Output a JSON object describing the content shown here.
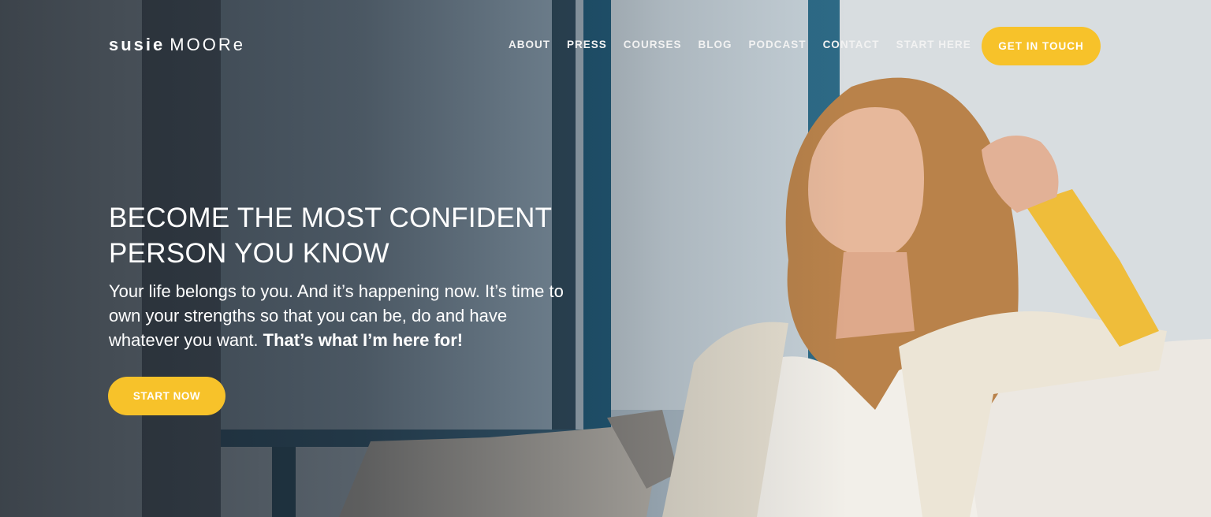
{
  "brand": {
    "first": "susie",
    "last": "MOORe"
  },
  "nav": {
    "items": [
      {
        "label": "ABOUT"
      },
      {
        "label": "PRESS"
      },
      {
        "label": "COURSES"
      },
      {
        "label": "BLOG"
      },
      {
        "label": "PODCAST"
      },
      {
        "label": "CONTACT"
      },
      {
        "label": "START HERE"
      }
    ],
    "cta_label": "GET IN TOUCH"
  },
  "hero": {
    "headline_line1": "BECOME THE MOST CONFIDENT",
    "headline_line2": "PERSON YOU KNOW",
    "subtext": "Your life belongs to you. And it’s happening now. It’s time to own your strengths so that you can be, do and have whatever you want.",
    "subtext_bold": "That’s what I’m here for!",
    "button_label": "START NOW"
  },
  "colors": {
    "accent": "#f7c22a",
    "text": "#ffffff"
  }
}
